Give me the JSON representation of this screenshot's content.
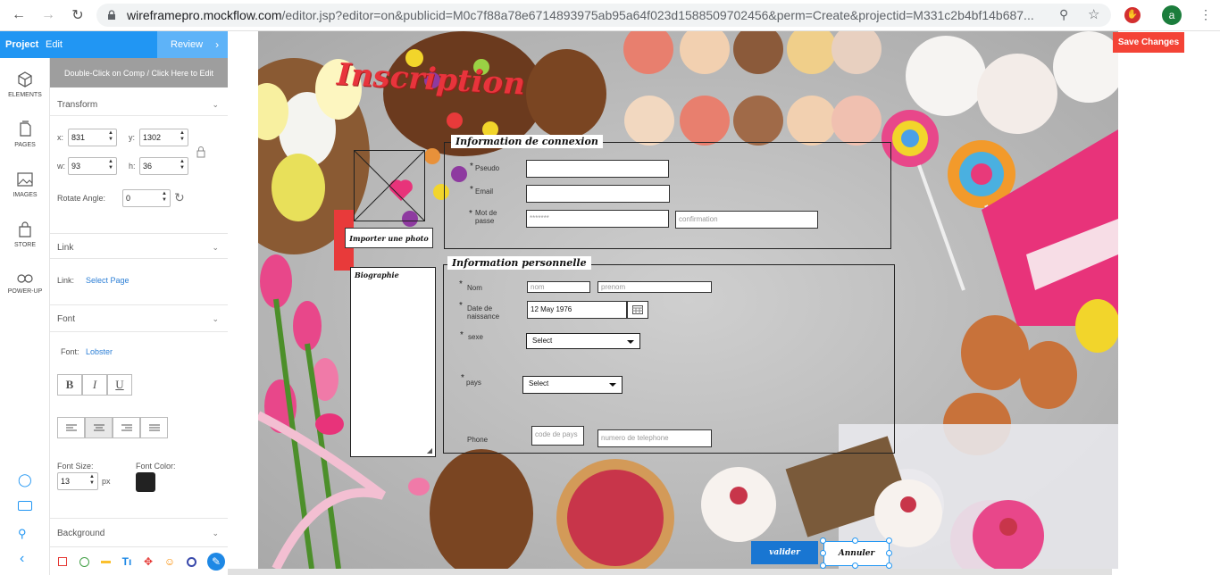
{
  "browser": {
    "url_host": "wireframepro.mockflow.com",
    "url_rest": "/editor.jsp?editor=on&publicid=M0c7f88a78e6714893975ab95a64f023d1588509702456&perm=Create&projectid=M331c2b4bf14b687...",
    "profile_initial": "a"
  },
  "topbar": {
    "project": "Project",
    "edit": "Edit",
    "review": "Review"
  },
  "rail": {
    "elements": "ELEMENTS",
    "pages": "PAGES",
    "images": "IMAGES",
    "store": "STORE",
    "powerup": "POWER-UP"
  },
  "panel": {
    "hint": "Double-Click on Comp / Click Here to Edit",
    "transform": "Transform",
    "x_label": "x:",
    "x": "831",
    "y_label": "y:",
    "y": "1302",
    "w_label": "w:",
    "w": "93",
    "h_label": "h:",
    "h": "36",
    "rotate_label": "Rotate Angle:",
    "rotate": "0",
    "link_section": "Link",
    "link_label": "Link:",
    "link_value": "Select Page",
    "font_section": "Font",
    "font_label": "Font:",
    "font_value": "Lobster",
    "bold": "B",
    "italic": "I",
    "underline": "U",
    "font_size_label": "Font Size:",
    "font_size": "13",
    "font_size_unit": "px",
    "font_color_label": "Font Color:",
    "font_color": "#222222",
    "background_section": "Background"
  },
  "save_changes": "Save Changes",
  "form": {
    "title": "Inscription",
    "photo_button": "Importer une photo",
    "login_legend": "Information de connexion",
    "pseudo_label": "Pseudo",
    "email_label": "Email",
    "password_label": "Mot de passe",
    "password_value": "*******",
    "confirm_placeholder": "confirmation",
    "bio_label": "Biographie",
    "personal_legend": "Information personnelle",
    "nom_label": "Nom",
    "nom_placeholder": "nom",
    "prenom_placeholder": "prenom",
    "birth_label": "Date de naissance",
    "birth_value": "12 May 1976",
    "sexe_label": "sexe",
    "sexe_value": "Select",
    "pays_label": "pays",
    "pays_value": "Select",
    "phone_label": "Phone",
    "country_code_placeholder": "code de pays",
    "phone_placeholder": "numero de telephone",
    "submit": "valider",
    "cancel": "Annuler",
    "required_mark": "*"
  },
  "colors": {
    "accent": "#2196f3",
    "save": "#f44336",
    "title": "#e8343c",
    "submit": "#1976d2"
  }
}
